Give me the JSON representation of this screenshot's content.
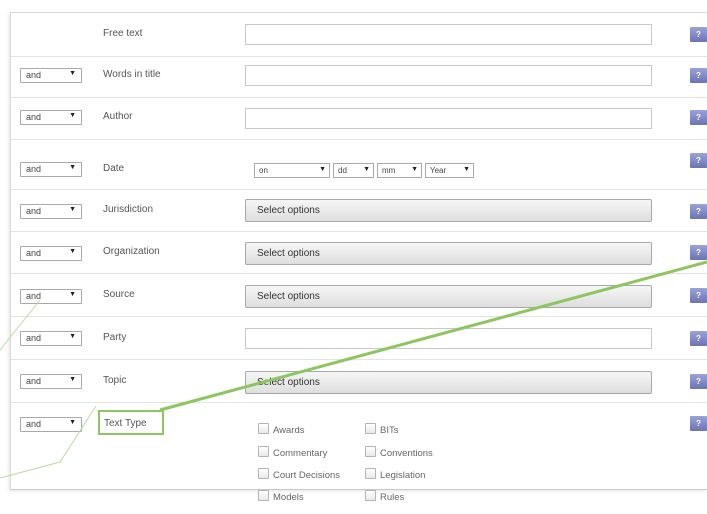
{
  "help_label": "?",
  "rows": [
    {
      "operator": "",
      "label": "Free text"
    },
    {
      "operator": "and",
      "label": "Words in title"
    },
    {
      "operator": "and",
      "label": "Author"
    },
    {
      "operator": "and",
      "label": "Date"
    },
    {
      "operator": "and",
      "label": "Jurisdiction",
      "field_value": "Select options"
    },
    {
      "operator": "and",
      "label": "Organization",
      "field_value": "Select options"
    },
    {
      "operator": "and",
      "label": "Source",
      "field_value": "Select options"
    },
    {
      "operator": "and",
      "label": "Party"
    },
    {
      "operator": "and",
      "label": "Topic",
      "field_value": "Select options"
    },
    {
      "operator": "and",
      "label": "Text Type"
    }
  ],
  "date": {
    "qualifier": "on",
    "day": "dd",
    "month": "mm",
    "year": "Year"
  },
  "text_types": [
    "Awards",
    "BITs",
    "Commentary",
    "Conventions",
    "Court Decisions",
    "Legislation",
    "Models",
    "Rules"
  ],
  "colors": {
    "highlight": "#8dc561",
    "help_button": "#7a82c0"
  }
}
